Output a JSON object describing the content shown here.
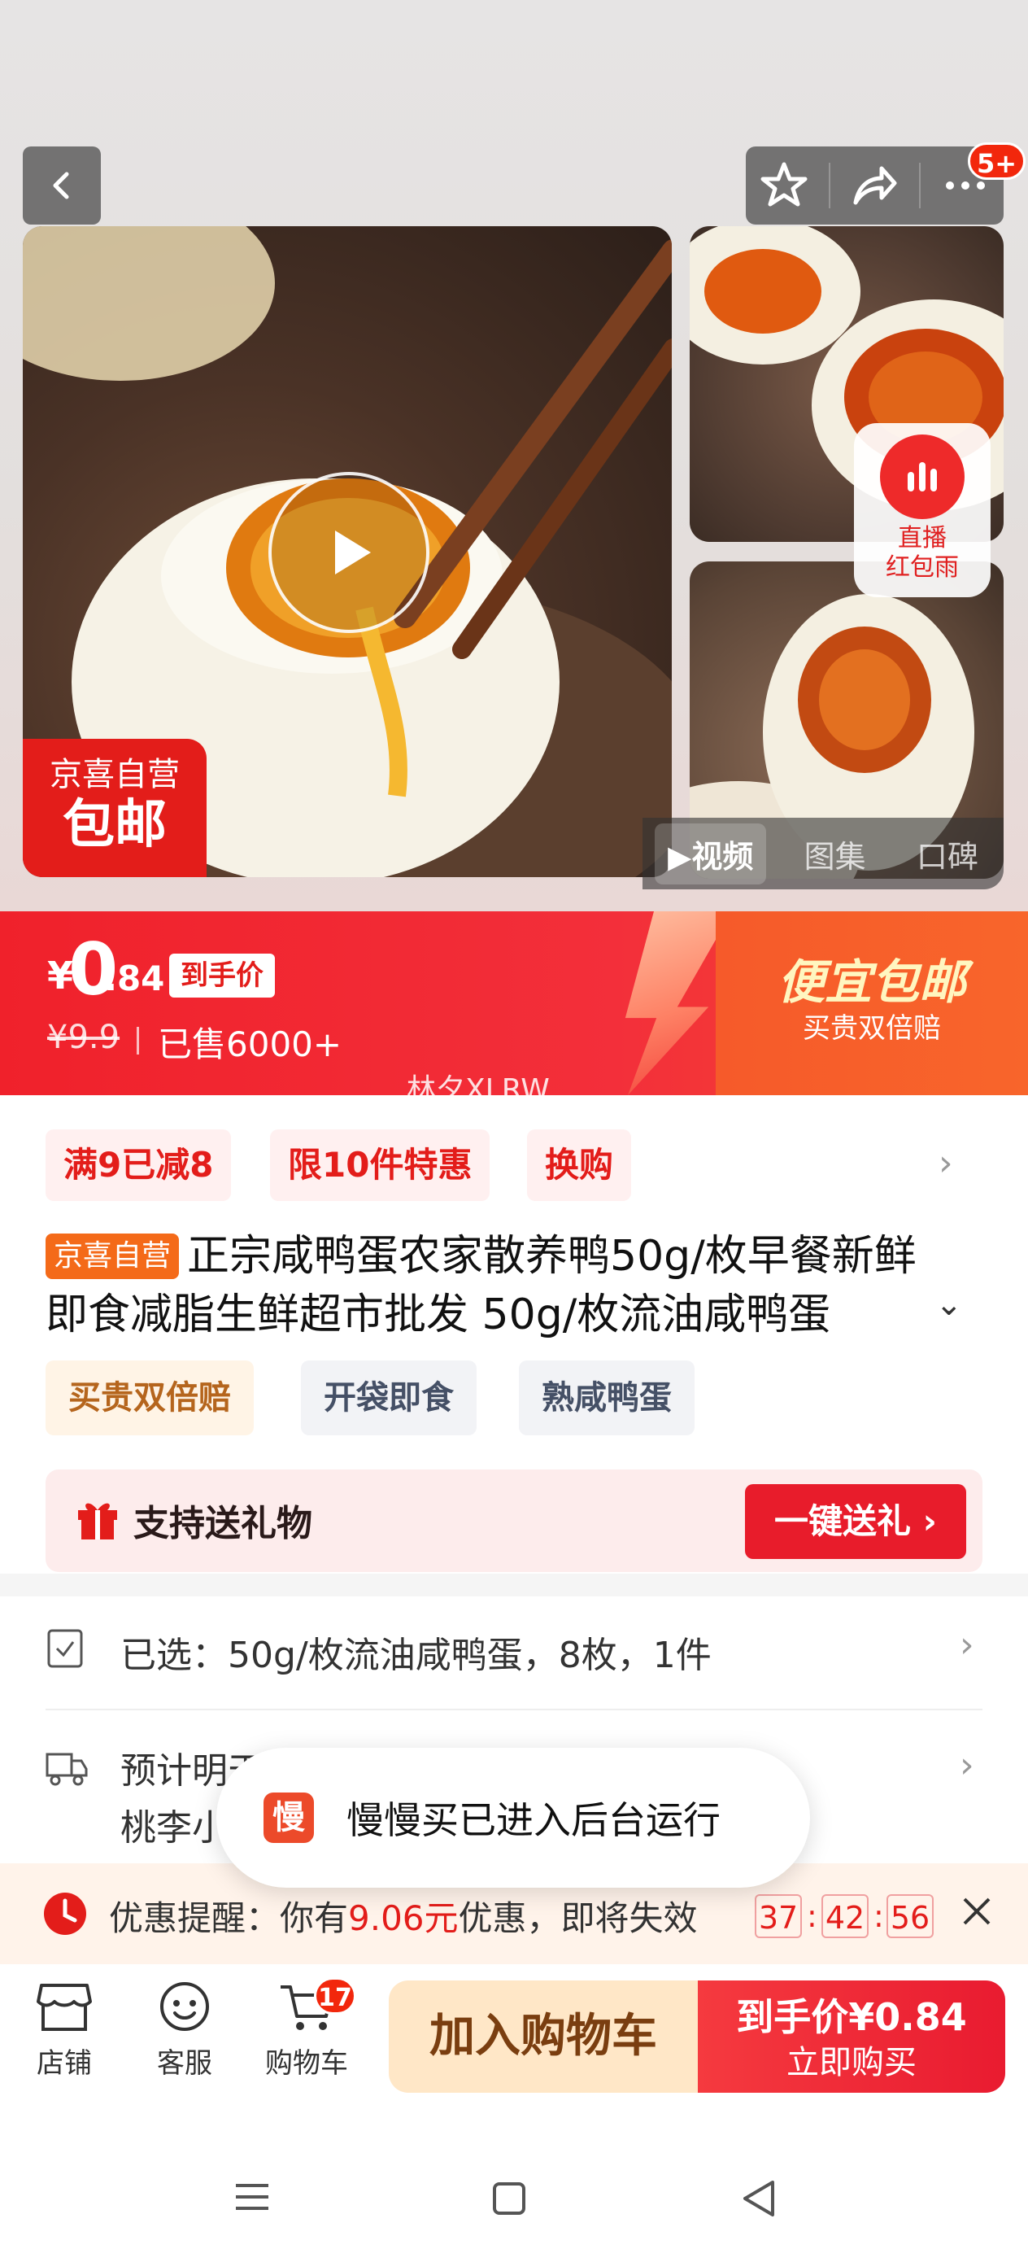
{
  "gallery": {
    "ribbon_line1": "京喜自营",
    "ribbon_line2": "包邮",
    "live_label_line1": "直播",
    "live_label_line2": "红包雨",
    "media_tabs": [
      "视频",
      "图集",
      "口碑"
    ],
    "active_tab": "视频",
    "notification_badge": "5+"
  },
  "price": {
    "currency": "¥",
    "integer": "0",
    "decimal": ".84",
    "tag": "到手价",
    "original": "¥9.9",
    "sold": "已售6000+",
    "right_title": "便宜包邮",
    "right_sub": "买贵双倍赔",
    "overlay_text": "林夕XLRW"
  },
  "promos": [
    "满9已减8",
    "限10件特惠",
    "换购"
  ],
  "title": {
    "tag": "京喜自营",
    "text": "正宗咸鸭蛋农家散养鸭50g/枚早餐新鲜即食减脂生鲜超市批发 50g/枚流油咸鸭蛋"
  },
  "services": [
    "买贵双倍赔",
    "开袋即食",
    "熟咸鸭蛋"
  ],
  "gift": {
    "label": "支持送礼物",
    "button": "一键送礼"
  },
  "selected": {
    "text": "已选：50g/枚流油咸鸭蛋，8枚，1件"
  },
  "delivery": {
    "line1": "预计明天送达",
    "line2": "桃李小区"
  },
  "toast": {
    "app_icon_char": "慢",
    "message": "慢慢买已进入后台运行"
  },
  "coupon": {
    "prefix": "优惠提醒：你有",
    "amount": "9.06元",
    "suffix": "优惠，即将失效",
    "timer": [
      "37",
      "42",
      "56"
    ]
  },
  "bottom_nav": {
    "store": "店铺",
    "service": "客服",
    "cart": "购物车",
    "cart_count": "17",
    "add_to_cart": "加入购物车",
    "buy_line1": "到手价¥0.84",
    "buy_line2": "立即购买"
  },
  "colors": {
    "brand_red": "#e31d1a",
    "price_banner": "#f0212b",
    "cart_btn_bg": "#ffe7c7"
  }
}
